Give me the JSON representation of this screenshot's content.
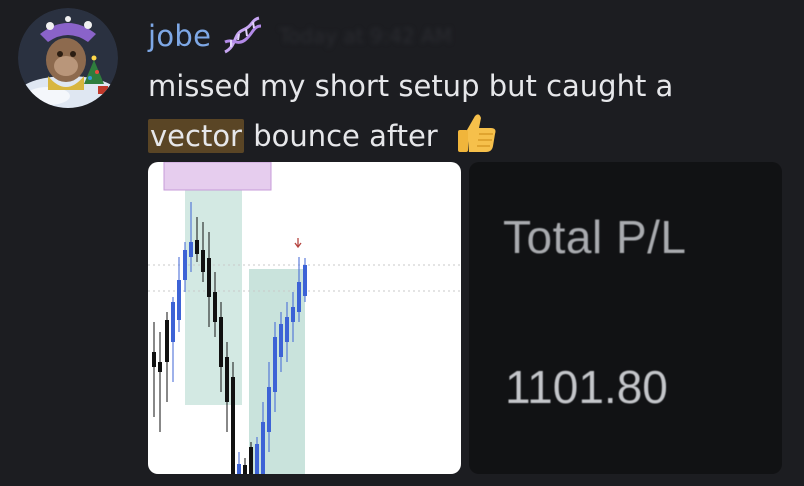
{
  "message": {
    "author": "jobe",
    "author_badge_icon": "dna-icon",
    "timestamp": "Today at 9:42 AM",
    "text_part1": "missed my short setup but caught a",
    "text_highlight": "vector",
    "text_part2": " bounce after",
    "emoji": "thumbs-up-icon"
  },
  "attachments": {
    "chart_image": "trading-candlestick-chart",
    "pl_image": {
      "label": "Total P/L",
      "value": "1101.80"
    }
  },
  "colors": {
    "background": "#1c1d21",
    "username": "#7ea8e6",
    "highlight": "#5a4525",
    "bull_candle": "#3d63d6",
    "bear_candle": "#111111",
    "zone_green": "#cfe6e0",
    "zone_purple": "#e2c9ec"
  }
}
